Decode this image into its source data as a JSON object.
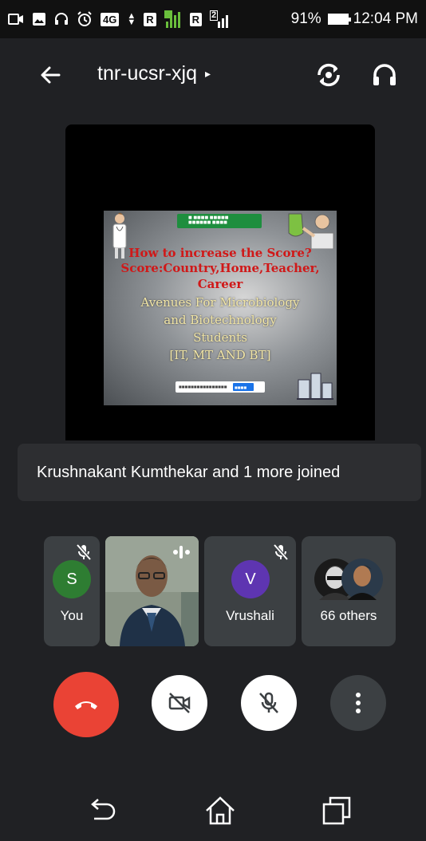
{
  "status_bar": {
    "net_type": "4G",
    "roaming_1": "R",
    "roaming_2": "R",
    "sim2_label": "2",
    "battery": "91%",
    "time": "12:04 PM"
  },
  "header": {
    "meeting_code": "tnr-ucsr-xjq",
    "caret": "▸"
  },
  "presentation": {
    "title_line1": "How to increase the Score?",
    "title_line2": "Score:Country,Home,Teacher,",
    "title_line3": "Career",
    "sub_line1": "Avenues For Microbiology",
    "sub_line2": "and Biotechnology",
    "sub_line3": "Students",
    "sub_line4": "[IT, MT AND BT]"
  },
  "toast": {
    "message": "Krushnakant Kumthekar and 1 more joined"
  },
  "participants": {
    "you": {
      "initial": "S",
      "name": "You",
      "color": "#2e7d32"
    },
    "vrushali": {
      "initial": "V",
      "name": "Vrushali",
      "color": "#5e35b1"
    },
    "others": {
      "name": "66 others"
    }
  },
  "colors": {
    "background": "#202124",
    "end_call": "#ea4335",
    "tile": "#3c4043"
  },
  "icons": {
    "back": "arrow-left-icon",
    "camera_switch": "camera-switch-icon",
    "audio": "headphones-icon",
    "end_call": "phone-hangup-icon",
    "camera_off": "camera-off-icon",
    "mic_off": "mic-off-icon",
    "more": "more-vert-icon"
  }
}
